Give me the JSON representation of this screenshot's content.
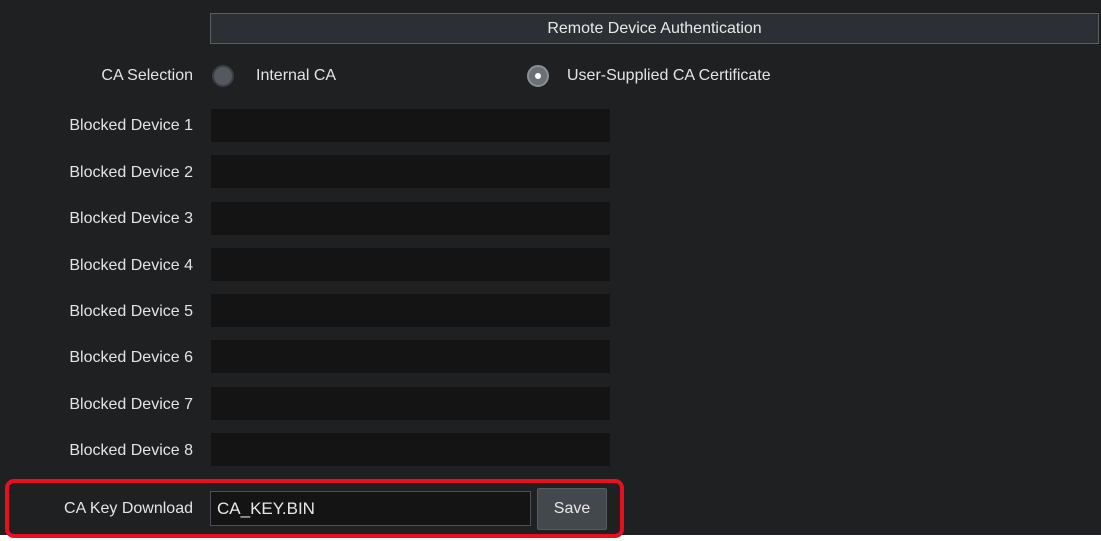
{
  "section": {
    "title": "Remote Device Authentication"
  },
  "ca_selection": {
    "label": "CA Selection",
    "selected": "User-Supplied CA Certificate",
    "options": [
      {
        "label": "Internal CA",
        "checked": false
      },
      {
        "label": "User-Supplied CA Certificate",
        "checked": true
      }
    ]
  },
  "blocked_devices": [
    {
      "label": "Blocked Device 1",
      "value": ""
    },
    {
      "label": "Blocked Device 2",
      "value": ""
    },
    {
      "label": "Blocked Device 3",
      "value": ""
    },
    {
      "label": "Blocked Device 4",
      "value": ""
    },
    {
      "label": "Blocked Device 5",
      "value": ""
    },
    {
      "label": "Blocked Device 6",
      "value": ""
    },
    {
      "label": "Blocked Device 7",
      "value": ""
    },
    {
      "label": "Blocked Device 8",
      "value": ""
    }
  ],
  "ca_key_download": {
    "label": "CA Key Download",
    "value": "CA_KEY.BIN",
    "button_label": "Save"
  },
  "colors": {
    "panel_background": "#1f2021",
    "field_background": "#141414",
    "highlight_border": "#e8101e",
    "text": "#e4e4e4"
  }
}
